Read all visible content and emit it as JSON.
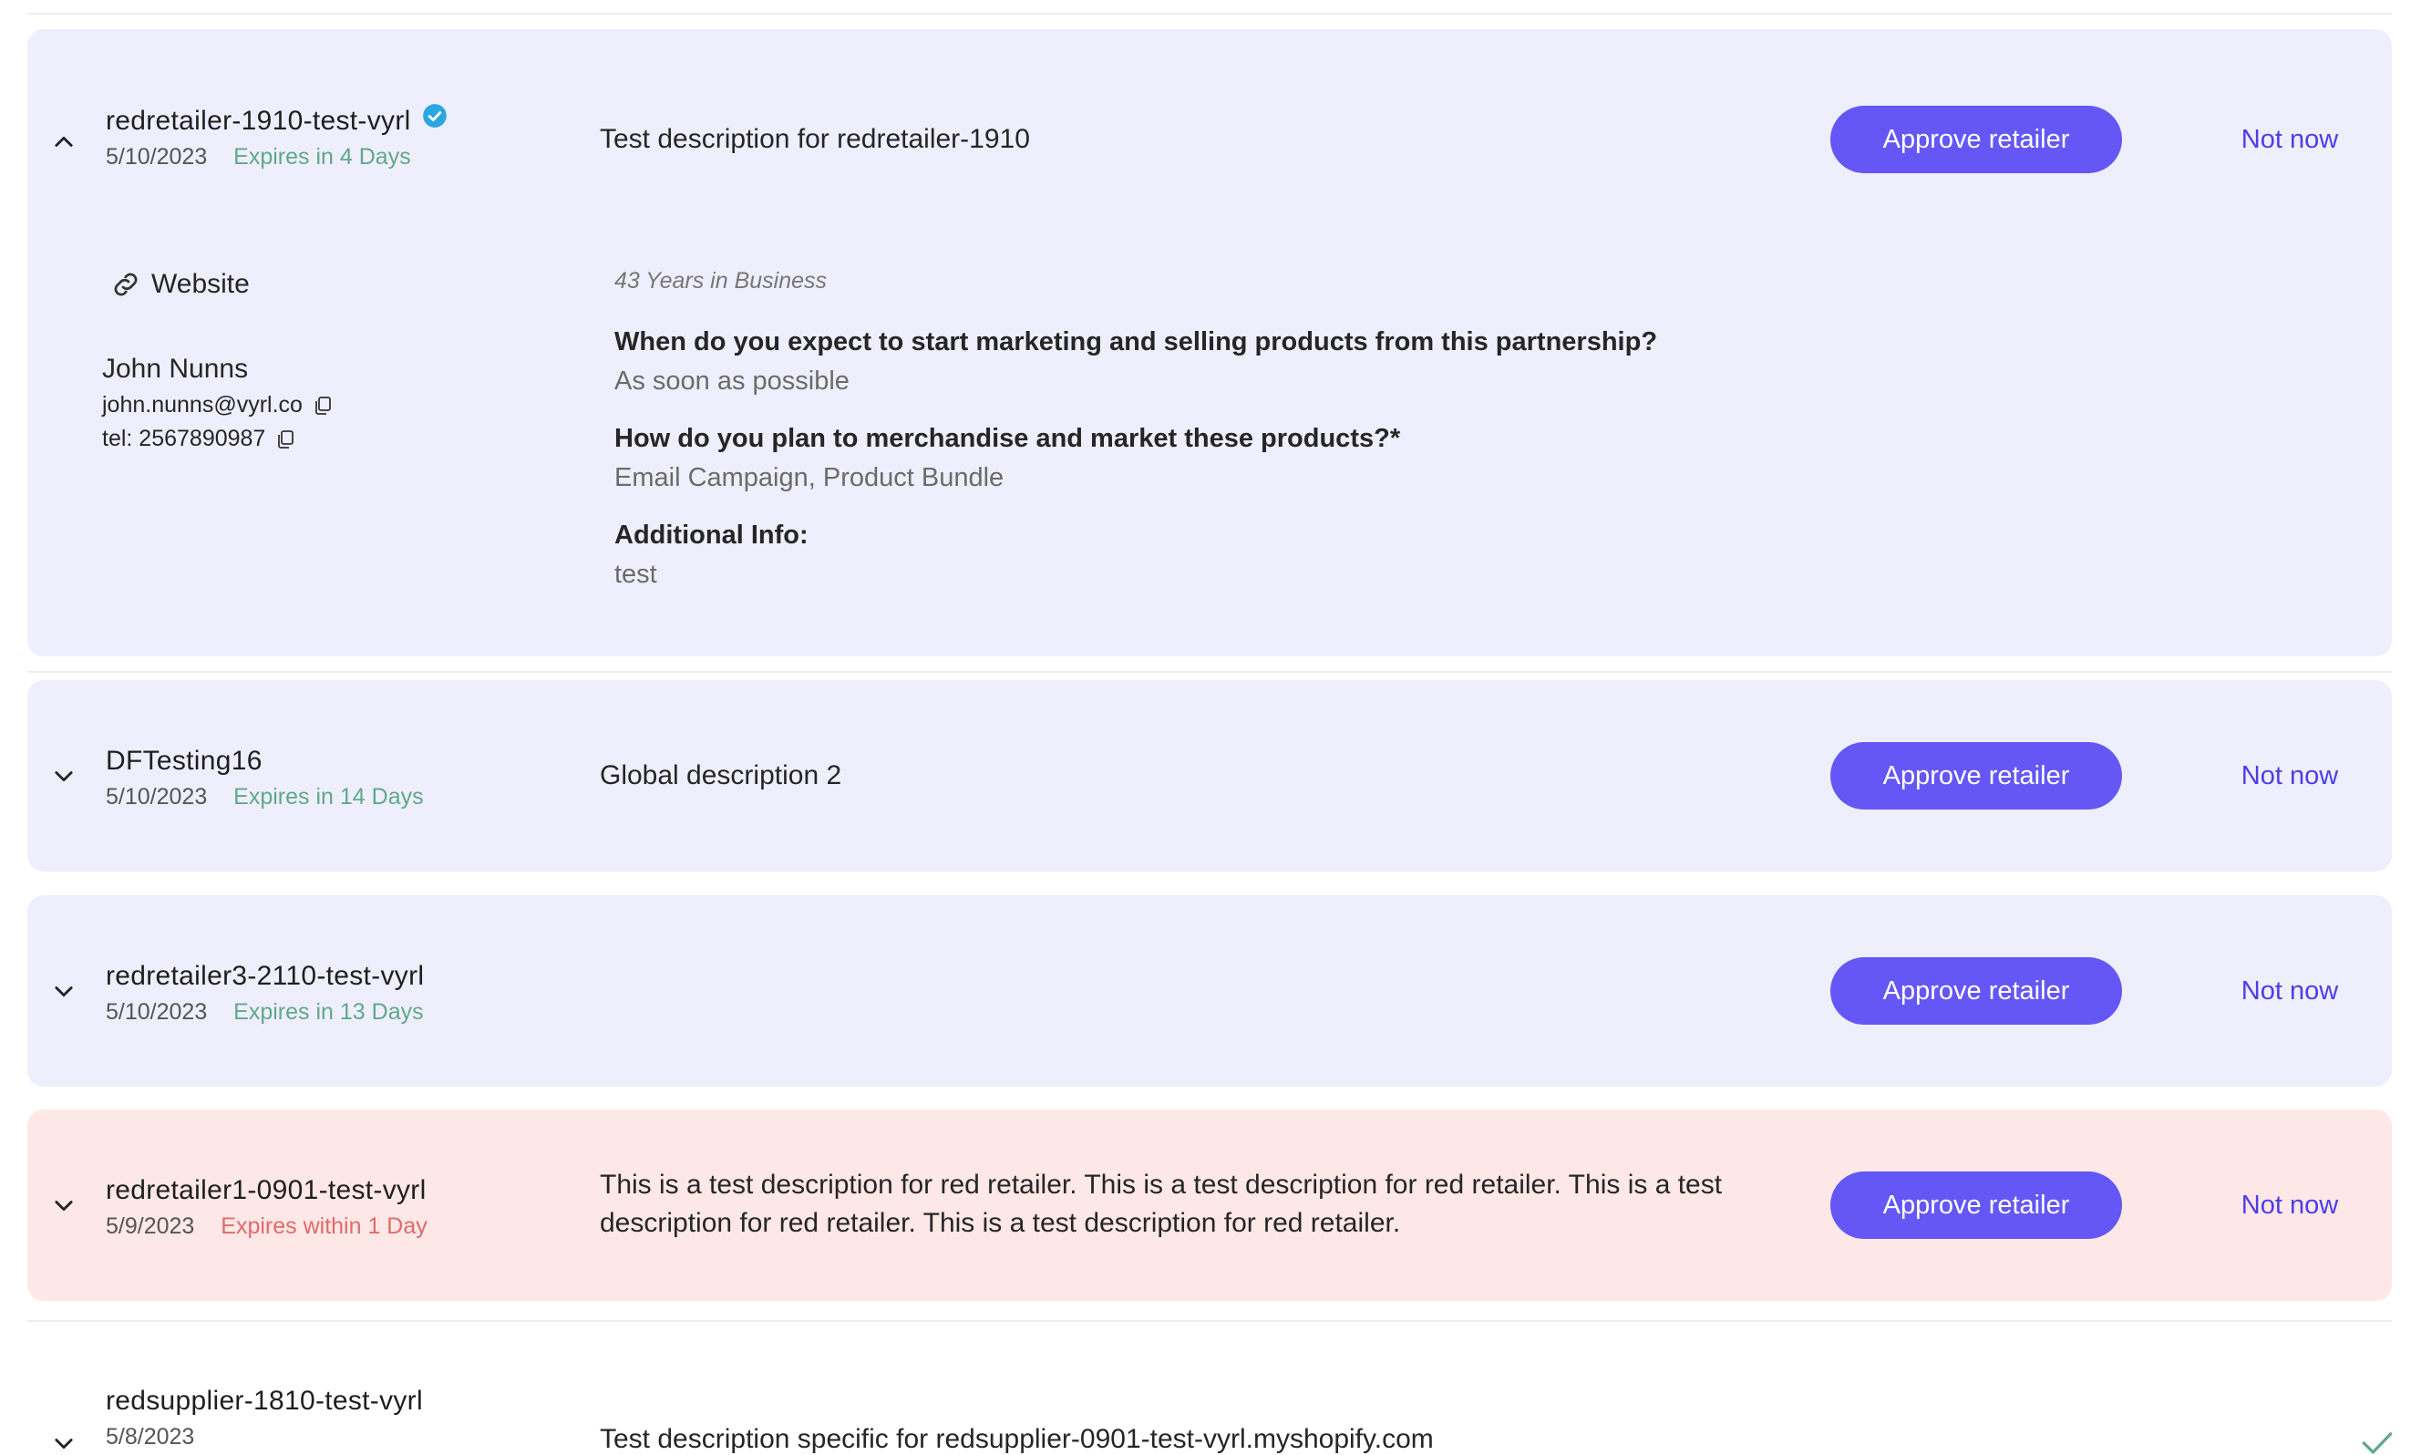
{
  "colors": {
    "card_default": "#efeefd",
    "card_alert": "#fde7e7",
    "approve_bg": "#6457f5",
    "not_now": "#4c3ee8",
    "expires_ok": "#5fa98a",
    "expires_urgent": "#e06a6a",
    "verified": "#2aa7e0",
    "check": "#5fa98a"
  },
  "rows": [
    {
      "name": "redretailer-1910-test-vyrl",
      "date": "5/10/2023",
      "expires": "Expires in 4 Days",
      "description": "Test description for redretailer-1910",
      "approve_label": "Approve retailer",
      "not_now_label": "Not now",
      "expanded": true,
      "verified_icon": "verified-badge-icon",
      "details": {
        "website_label": "Website",
        "contact_name": "John Nunns",
        "email": "john.nunns@vyrl.co",
        "phone": "tel: 2567890987",
        "years_in_business": "43 Years in Business",
        "q1": "When do you expect to start marketing and selling products from this partnership?",
        "a1": "As soon as possible",
        "q2": "How do you plan to merchandise and market these products?*",
        "a2": "Email Campaign, Product Bundle",
        "q3": "Additional Info:",
        "a3": "test"
      }
    },
    {
      "name": "DFTesting16",
      "date": "5/10/2023",
      "expires": "Expires in 14 Days",
      "description": "Global description 2",
      "approve_label": "Approve retailer",
      "not_now_label": "Not now"
    },
    {
      "name": "redretailer3-2110-test-vyrl",
      "date": "5/10/2023",
      "expires": "Expires in 13 Days",
      "description": "",
      "approve_label": "Approve retailer",
      "not_now_label": "Not now"
    },
    {
      "name": "redretailer1-0901-test-vyrl",
      "date": "5/9/2023",
      "expires": "Expires within 1 Day",
      "urgent": true,
      "description": "This is a test description for red retailer. This is a test description for red retailer. This is a test description for red retailer. This is a test description for red retailer.",
      "approve_label": "Approve retailer",
      "not_now_label": "Not now"
    },
    {
      "name": "redsupplier-1810-test-vyrl",
      "date": "5/8/2023",
      "description": "Test description specific for redsupplier-0901-test-vyrl.myshopify.com",
      "status_icon": "checkmark-icon"
    }
  ]
}
